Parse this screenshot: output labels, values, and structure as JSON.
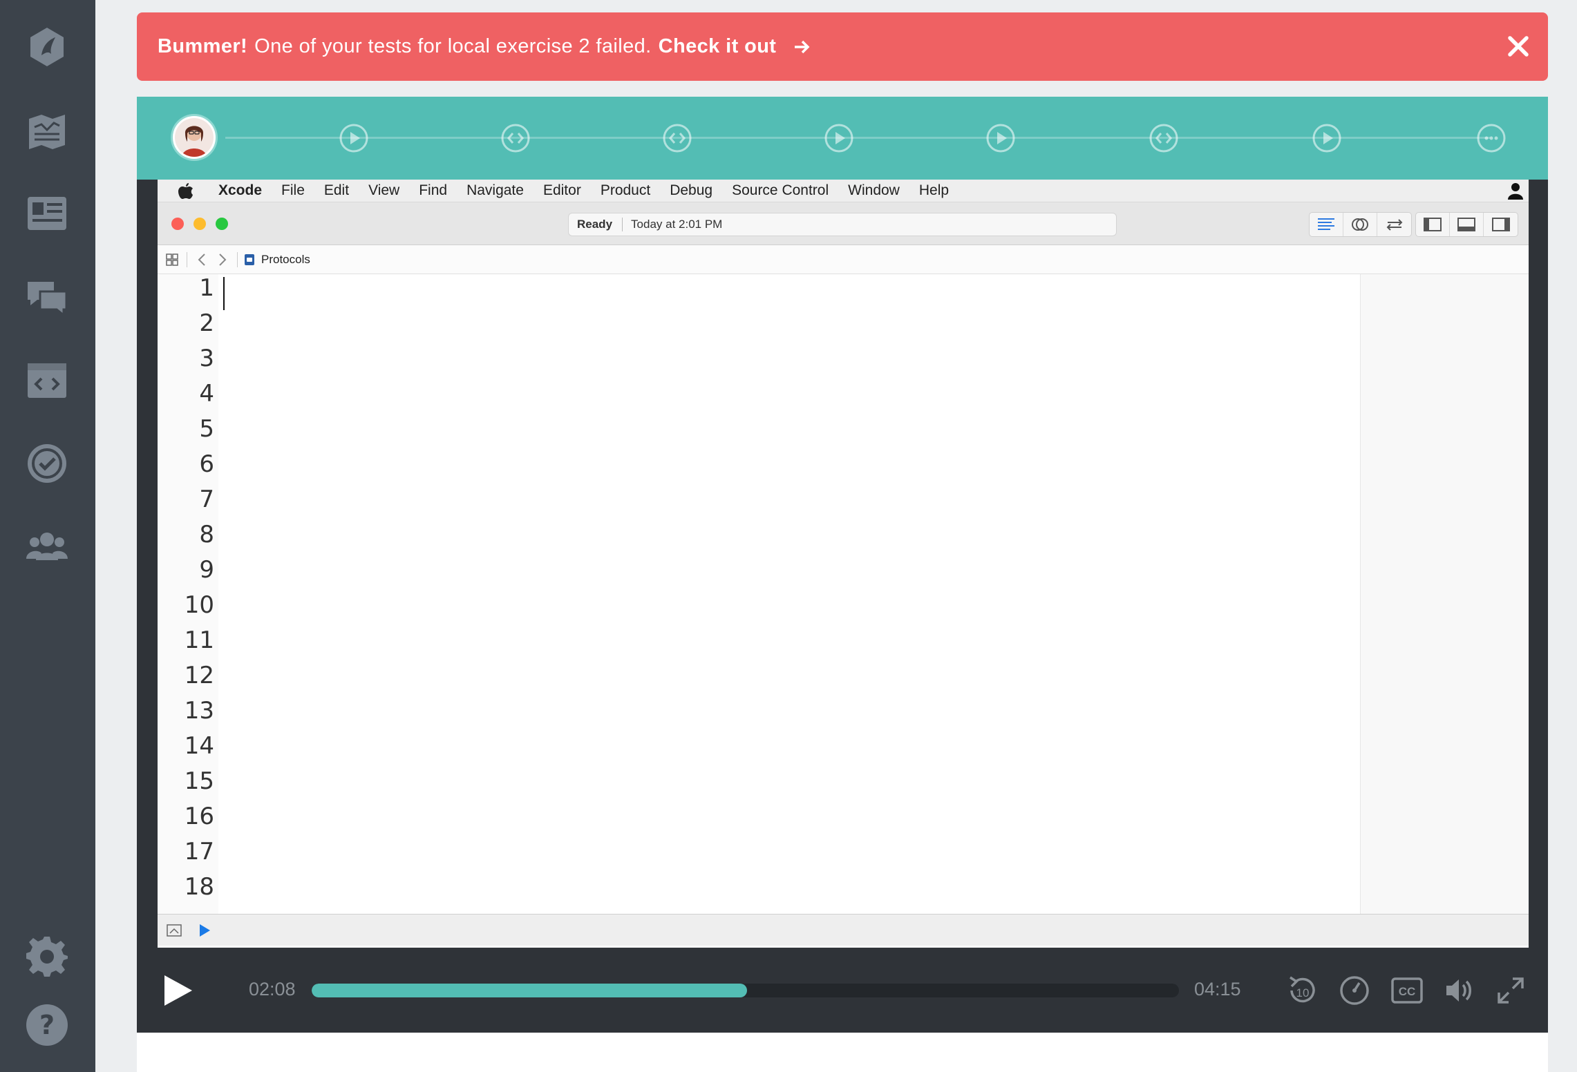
{
  "sidebar": {
    "icons": [
      "treehouse-logo-icon",
      "library-icon",
      "tracks-icon",
      "community-icon",
      "workspaces-icon",
      "techdegree-icon",
      "team-icon",
      "settings-icon",
      "help-icon"
    ]
  },
  "banner": {
    "strong": "Bummer!",
    "message": "One of your tests for local exercise 2 failed.",
    "cta": "Check it out",
    "background": "#ef6163"
  },
  "steps": {
    "accent": "#53bdb4",
    "nodes": [
      "avatar",
      "video",
      "code",
      "code",
      "video",
      "video",
      "code",
      "video",
      "more"
    ]
  },
  "xcode": {
    "menubar": [
      "Xcode",
      "File",
      "Edit",
      "View",
      "Find",
      "Navigate",
      "Editor",
      "Product",
      "Debug",
      "Source Control",
      "Window",
      "Help"
    ],
    "status": {
      "state": "Ready",
      "time": "Today at 2:01 PM"
    },
    "jumpbar": {
      "file": "Protocols"
    },
    "line_numbers": [
      "1",
      "2",
      "3",
      "4",
      "5",
      "6",
      "7",
      "8",
      "9",
      "10",
      "11",
      "12",
      "13",
      "14",
      "15",
      "16",
      "17",
      "18"
    ]
  },
  "player": {
    "current_time": "02:08",
    "duration": "04:15",
    "progress": 0.502
  }
}
